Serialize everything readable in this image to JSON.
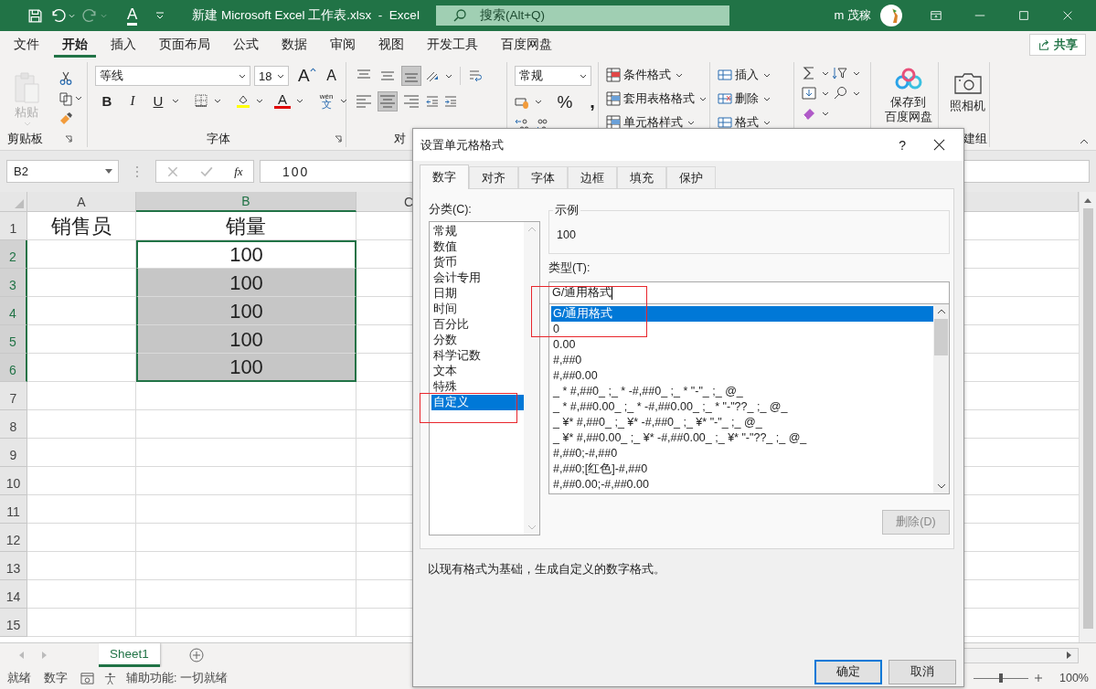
{
  "window": {
    "title": "新建 Microsoft Excel 工作表.xlsx  -  Excel",
    "redo_disabled": true,
    "font_color_button": "A",
    "search_placeholder": "搜索(Alt+Q)",
    "user": "m 茂稼"
  },
  "menu_tabs": [
    {
      "label": "文件",
      "selected": false
    },
    {
      "label": "开始",
      "selected": true
    },
    {
      "label": "插入",
      "selected": false
    },
    {
      "label": "页面布局",
      "selected": false
    },
    {
      "label": "公式",
      "selected": false
    },
    {
      "label": "数据",
      "selected": false
    },
    {
      "label": "审阅",
      "selected": false
    },
    {
      "label": "视图",
      "selected": false
    },
    {
      "label": "开发工具",
      "selected": false
    },
    {
      "label": "百度网盘",
      "selected": false
    }
  ],
  "share_button": "共享",
  "ribbon": {
    "clipboard": {
      "paste": "粘贴",
      "paste_disabled": true,
      "label": "剪贴板"
    },
    "font": {
      "name": "等线",
      "size": "18",
      "grow": "A",
      "shrink": "A",
      "bold": "B",
      "italic": "I",
      "underline": "U",
      "font_color": "A",
      "phonetic_top": "wén",
      "phonetic_bottom": "文",
      "label": "字体"
    },
    "alignment": {
      "label": "对",
      "vertical_align": [
        {
          "kind": "top",
          "selected": false
        },
        {
          "kind": "middle",
          "selected": false
        },
        {
          "kind": "bottom",
          "selected": true
        }
      ],
      "horizontal_align": [
        {
          "kind": "left",
          "selected": false
        },
        {
          "kind": "center",
          "selected": true
        },
        {
          "kind": "right",
          "selected": false
        }
      ]
    },
    "number": {
      "format": "常规",
      "percent": "%",
      "comma": ","
    },
    "styles": [
      "条件格式",
      "套用表格格式",
      "单元格样式"
    ],
    "cells": [
      "插入",
      "删除",
      "格式"
    ],
    "baidu": [
      "保存到",
      "百度网盘"
    ],
    "camera": {
      "label": "照相机",
      "group_label": "建组"
    }
  },
  "formula_bar": {
    "name_box": "B2",
    "fx": "fx",
    "value": "100"
  },
  "sheet": {
    "columns": [
      {
        "label": "A",
        "selected": false
      },
      {
        "label": "B",
        "selected": true
      },
      {
        "label": "C",
        "selected": false
      }
    ],
    "rows": [
      {
        "number": "1",
        "selected": false,
        "cells": [
          {
            "text": "销售员",
            "selected": false,
            "active": false
          },
          {
            "text": "销量",
            "selected": false,
            "active": false
          }
        ]
      },
      {
        "number": "2",
        "selected": true,
        "cells": [
          {
            "selected": false,
            "active": false
          },
          {
            "text": "100",
            "selected": true,
            "active": true
          }
        ]
      },
      {
        "number": "3",
        "selected": true,
        "cells": [
          {
            "selected": false,
            "active": false
          },
          {
            "text": "100",
            "selected": true,
            "active": false
          }
        ]
      },
      {
        "number": "4",
        "selected": true,
        "cells": [
          {
            "selected": false,
            "active": false
          },
          {
            "text": "100",
            "selected": true,
            "active": false
          }
        ]
      },
      {
        "number": "5",
        "selected": true,
        "cells": [
          {
            "selected": false,
            "active": false
          },
          {
            "text": "100",
            "selected": true,
            "active": false
          }
        ]
      },
      {
        "number": "6",
        "selected": true,
        "cells": [
          {
            "selected": false,
            "active": false
          },
          {
            "text": "100",
            "selected": true,
            "active": false
          }
        ]
      },
      {
        "number": "7",
        "selected": false
      },
      {
        "number": "8",
        "selected": false
      },
      {
        "number": "9",
        "selected": false
      },
      {
        "number": "10",
        "selected": false
      },
      {
        "number": "11",
        "selected": false
      },
      {
        "number": "12",
        "selected": false
      },
      {
        "number": "13",
        "selected": false
      },
      {
        "number": "14",
        "selected": false
      },
      {
        "number": "15",
        "selected": false
      }
    ]
  },
  "sheet_tabs": [
    {
      "label": "Sheet1",
      "selected": true
    }
  ],
  "status_bar": {
    "ready": "就绪",
    "mode": "数字",
    "accessibility": "辅助功能: 一切就绪",
    "zoom_slider": {
      "level": 0.5
    },
    "zoom": "100%"
  },
  "dialog": {
    "title": "设置单元格格式",
    "help": "?",
    "tabs": [
      {
        "label": "数字",
        "selected": true
      },
      {
        "label": "对齐",
        "selected": false
      },
      {
        "label": "字体",
        "selected": false
      },
      {
        "label": "边框",
        "selected": false
      },
      {
        "label": "填充",
        "selected": false
      },
      {
        "label": "保护",
        "selected": false
      }
    ],
    "category_label": "分类(C):",
    "categories": [
      {
        "label": "常规",
        "selected": false
      },
      {
        "label": "数值",
        "selected": false
      },
      {
        "label": "货币",
        "selected": false
      },
      {
        "label": "会计专用",
        "selected": false
      },
      {
        "label": "日期",
        "selected": false
      },
      {
        "label": "时间",
        "selected": false
      },
      {
        "label": "百分比",
        "selected": false
      },
      {
        "label": "分数",
        "selected": false
      },
      {
        "label": "科学记数",
        "selected": false
      },
      {
        "label": "文本",
        "selected": false
      },
      {
        "label": "特殊",
        "selected": false
      },
      {
        "label": "自定义",
        "selected": true
      }
    ],
    "sample_label": "示例",
    "sample_value": "100",
    "type_label": "类型(T):",
    "type_value": "G/通用格式",
    "formats": [
      {
        "label": "G/通用格式",
        "selected": true
      },
      {
        "label": "0",
        "selected": false
      },
      {
        "label": "0.00",
        "selected": false
      },
      {
        "label": "#,##0",
        "selected": false
      },
      {
        "label": "#,##0.00",
        "selected": false
      },
      {
        "label": "_ * #,##0_ ;_ * -#,##0_ ;_ * \"-\"_ ;_ @_",
        "selected": false
      },
      {
        "label": "_ * #,##0.00_ ;_ * -#,##0.00_ ;_ * \"-\"??_ ;_ @_",
        "selected": false
      },
      {
        "label": "_ ¥* #,##0_ ;_ ¥* -#,##0_ ;_ ¥* \"-\"_ ;_ @_",
        "selected": false
      },
      {
        "label": "_ ¥* #,##0.00_ ;_ ¥* -#,##0.00_ ;_ ¥* \"-\"??_ ;_ @_",
        "selected": false
      },
      {
        "label": "#,##0;-#,##0",
        "selected": false
      },
      {
        "label": "#,##0;[红色]-#,##0",
        "selected": false
      },
      {
        "label": "#,##0.00;-#,##0.00",
        "selected": false
      }
    ],
    "delete_button": {
      "label": "删除(D)",
      "disabled": true
    },
    "description": "以现有格式为基础，生成自定义的数字格式。",
    "ok_button": "确定",
    "cancel_button": "取消"
  }
}
